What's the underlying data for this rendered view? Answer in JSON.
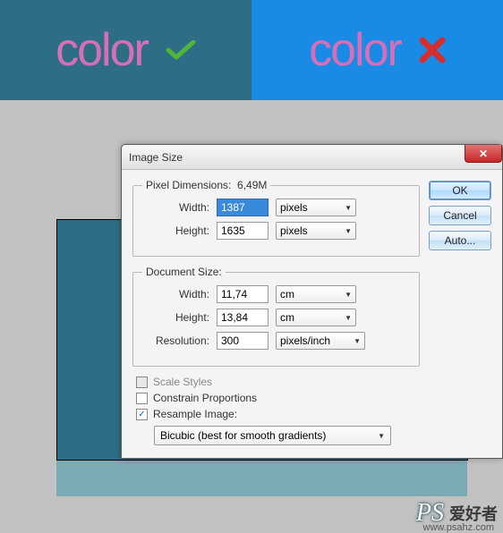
{
  "banner": {
    "left_text": "color",
    "right_text": "color"
  },
  "dialog": {
    "title": "Image Size",
    "pixel_dimensions": {
      "legend": "Pixel Dimensions:",
      "size": "6,49M",
      "width_label": "Width:",
      "width_value": "1387",
      "height_label": "Height:",
      "height_value": "1635",
      "unit": "pixels"
    },
    "document_size": {
      "legend": "Document Size:",
      "width_label": "Width:",
      "width_value": "11,74",
      "height_label": "Height:",
      "height_value": "13,84",
      "resolution_label": "Resolution:",
      "resolution_value": "300",
      "unit": "cm",
      "res_unit": "pixels/inch"
    },
    "checkboxes": {
      "scale_styles": "Scale Styles",
      "constrain": "Constrain Proportions",
      "resample": "Resample Image:"
    },
    "resample_method": "Bicubic (best for smooth gradients)",
    "buttons": {
      "ok": "OK",
      "cancel": "Cancel",
      "auto": "Auto..."
    }
  },
  "watermark": {
    "ps": "PS",
    "cn": "爱好者",
    "url": "www.psahz.com"
  }
}
